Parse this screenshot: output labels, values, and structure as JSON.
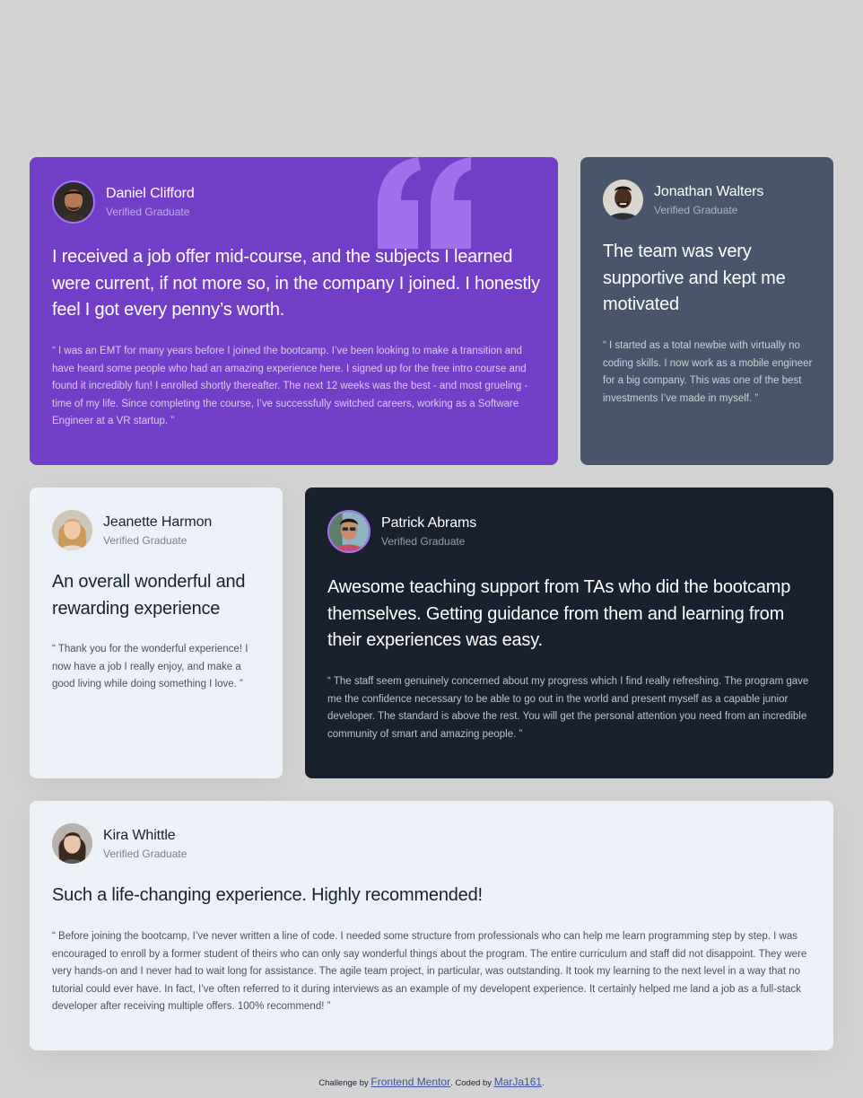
{
  "testimonials": [
    {
      "name": "Daniel Clifford",
      "role": "Verified Graduate",
      "headline": "I received a job offer mid-course, and the subjects I learned were current, if not more so, in the company I joined. I honestly feel I got every penny’s worth.",
      "quote": "“ I was an EMT for many years before I joined the bootcamp. I’ve been looking to make a transition and have heard some people who had an amazing experience here. I signed up for the free intro course and found it incredibly fun! I enrolled shortly thereafter. The next 12 weeks was the best - and most grueling - time of my life. Since completing the course, I’ve successfully switched careers, working as a Software Engineer at a VR startup. ”"
    },
    {
      "name": "Jonathan Walters",
      "role": "Verified Graduate",
      "headline": "The team was very supportive and kept me motivated",
      "quote": "“ I started as a total newbie with virtually no coding skills. I now work as a mobile engineer for a big company. This was one of the best investments I’ve made in myself. ”"
    },
    {
      "name": "Jeanette Harmon",
      "role": "Verified Graduate",
      "headline": "An overall wonderful and rewarding experience",
      "quote": "“ Thank you for the wonderful experience! I now have a job I really enjoy, and make a good living while doing something I love. ”"
    },
    {
      "name": "Patrick Abrams",
      "role": "Verified Graduate",
      "headline": "Awesome teaching support from TAs who did the bootcamp themselves. Getting guidance from them and learning from their experiences was easy.",
      "quote": "“ The staff seem genuinely concerned about my progress which I find really refreshing. The program gave me the confidence necessary to be able to go out in the world and present myself as a capable junior developer. The standard is above the rest. You will get the personal attention you need from an incredible community of smart and amazing people. ”"
    },
    {
      "name": "Kira Whittle",
      "role": "Verified Graduate",
      "headline": "Such a life-changing experience. Highly recommended!",
      "quote": "“ Before joining the bootcamp, I’ve never written a line of code. I needed some structure from professionals who can help me learn programming step by step. I was encouraged to enroll by a former student of theirs who can only say wonderful things about the program. The entire curriculum and staff did not disappoint. They were very hands-on and I never had to wait long for assistance. The agile team project, in particular, was outstanding. It took my learning to the next level in a way that no tutorial could ever have. In fact, I’ve often referred to it during interviews as an example of my developent experience. It certainly helped me land a job as a full-stack developer after receiving multiple offers. 100% recommend! ”"
    }
  ],
  "attribution": {
    "prefix": "Challenge by",
    "link1": "Frontend Mentor",
    "middle": ". Coded by",
    "link2": "MarJa161",
    "suffix": "."
  },
  "colors": {
    "background": "#d2d2d2",
    "purple": "#733fc8",
    "grey_blue": "#48556a",
    "light": "#ecf1f8",
    "dark": "#19212e",
    "avatar_ring": "#a775f1"
  },
  "icons": {
    "quote_mark": "quotation-mark-icon"
  }
}
